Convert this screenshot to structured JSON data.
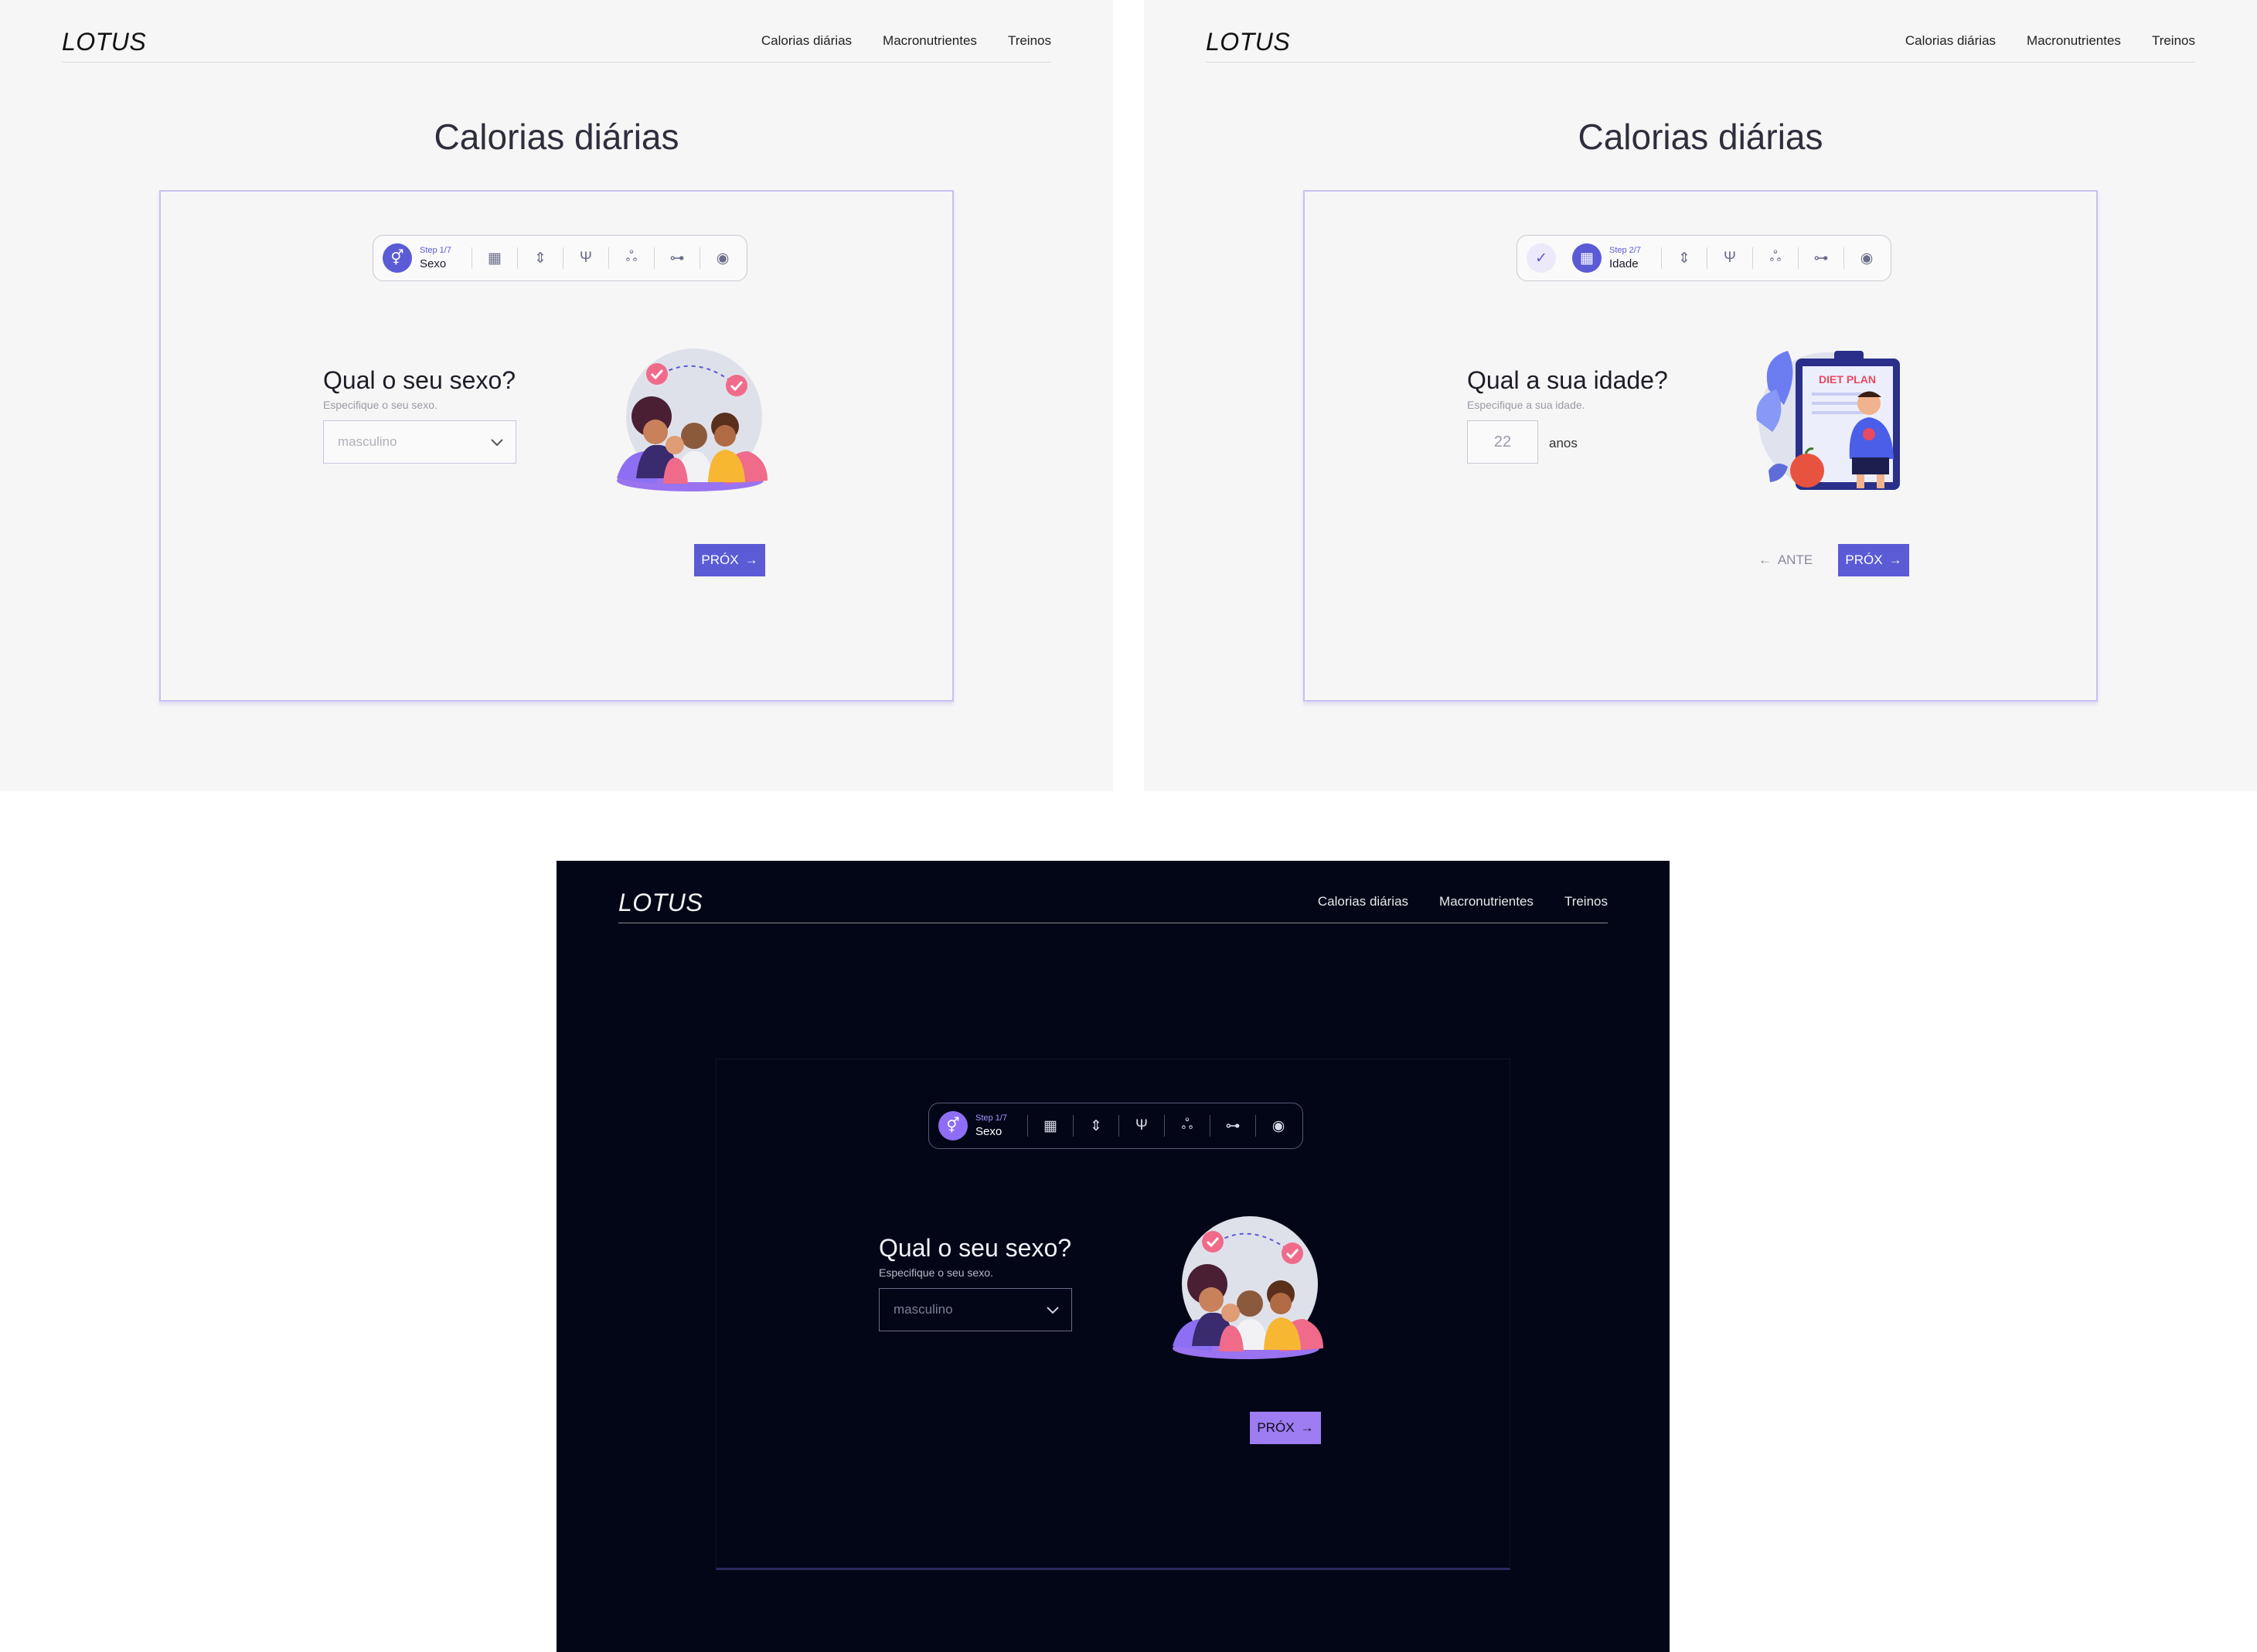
{
  "screens": [
    {
      "theme": "light",
      "header": {
        "logo": "LOTUS",
        "nav": [
          "Calorias diárias",
          "Macronutrientes",
          "Treinos"
        ]
      },
      "page_title": "Calorias diárias",
      "stepper": {
        "step_label": "Step 1/7",
        "step_name": "Sexo",
        "icons": [
          "gender-icon",
          "calendar-icon",
          "height-icon",
          "fork-knife-icon",
          "bicycle-icon",
          "dumbbell-icon",
          "user-circle-icon"
        ]
      },
      "form": {
        "question": "Qual o seu sexo?",
        "hint": "Especifique o seu sexo.",
        "select_value": "masculino"
      },
      "buttons": {
        "next": "PRÓX"
      }
    },
    {
      "theme": "light",
      "header": {
        "logo": "LOTUS",
        "nav": [
          "Calorias diárias",
          "Macronutrientes",
          "Treinos"
        ]
      },
      "page_title": "Calorias diárias",
      "stepper": {
        "step_label": "Step 2/7",
        "step_name": "Idade",
        "icons": [
          "check-icon",
          "calendar-icon",
          "height-icon",
          "fork-knife-icon",
          "bicycle-icon",
          "dumbbell-icon",
          "user-circle-icon"
        ]
      },
      "form": {
        "question": "Qual a sua idade?",
        "hint": "Especifique a sua idade.",
        "age_value": "22",
        "unit": "anos",
        "illustration_text": "DIET PLAN"
      },
      "buttons": {
        "prev": "ANTE",
        "next": "PRÓX"
      }
    },
    {
      "theme": "dark",
      "header": {
        "logo": "LOTUS",
        "nav": [
          "Calorias diárias",
          "Macronutrientes",
          "Treinos"
        ]
      },
      "stepper": {
        "step_label": "Step 1/7",
        "step_name": "Sexo",
        "icons": [
          "gender-icon",
          "calendar-icon",
          "height-icon",
          "fork-knife-icon",
          "bicycle-icon",
          "dumbbell-icon",
          "user-circle-icon"
        ]
      },
      "form": {
        "question": "Qual o seu sexo?",
        "hint": "Especifique o seu sexo.",
        "select_value": "masculino"
      },
      "buttons": {
        "next": "PRÓX"
      }
    }
  ],
  "colors": {
    "accent": "#5b5bd6",
    "accent_dark_theme": "#9e7cf2",
    "dark_bg": "#020617",
    "light_bg": "#f6f6f6"
  }
}
